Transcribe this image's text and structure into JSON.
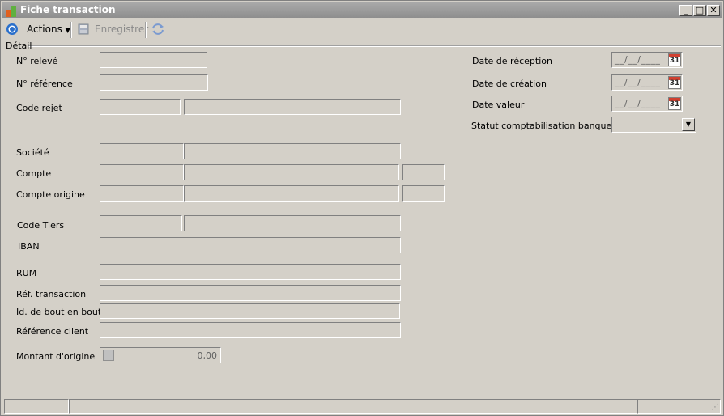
{
  "window": {
    "title": "Fiche transaction",
    "buttons": {
      "minimize": "_",
      "maximize": "□",
      "close": "✕"
    }
  },
  "toolbar": {
    "actions_label": "Actions",
    "save_label": "Enregistrer"
  },
  "section": {
    "title": "Détail"
  },
  "left": {
    "releve": "N° relevé",
    "reference": "N° référence",
    "code_rejet": "Code rejet",
    "societe": "Société",
    "compte": "Compte",
    "compte_origine": "Compte origine",
    "code_tiers": "Code Tiers",
    "iban": "IBAN",
    "rum": "RUM",
    "ref_transaction": "Réf. transaction",
    "id_bout": "Id. de bout en bout",
    "ref_client": "Référence client",
    "montant_origine": "Montant d'origine",
    "montant_value": "0,00"
  },
  "right": {
    "date_reception": "Date de réception",
    "date_creation": "Date de création",
    "date_valeur": "Date valeur",
    "statut": "Statut comptabilisation banque",
    "date_mask": "__/__/____",
    "cal_day": "31"
  }
}
